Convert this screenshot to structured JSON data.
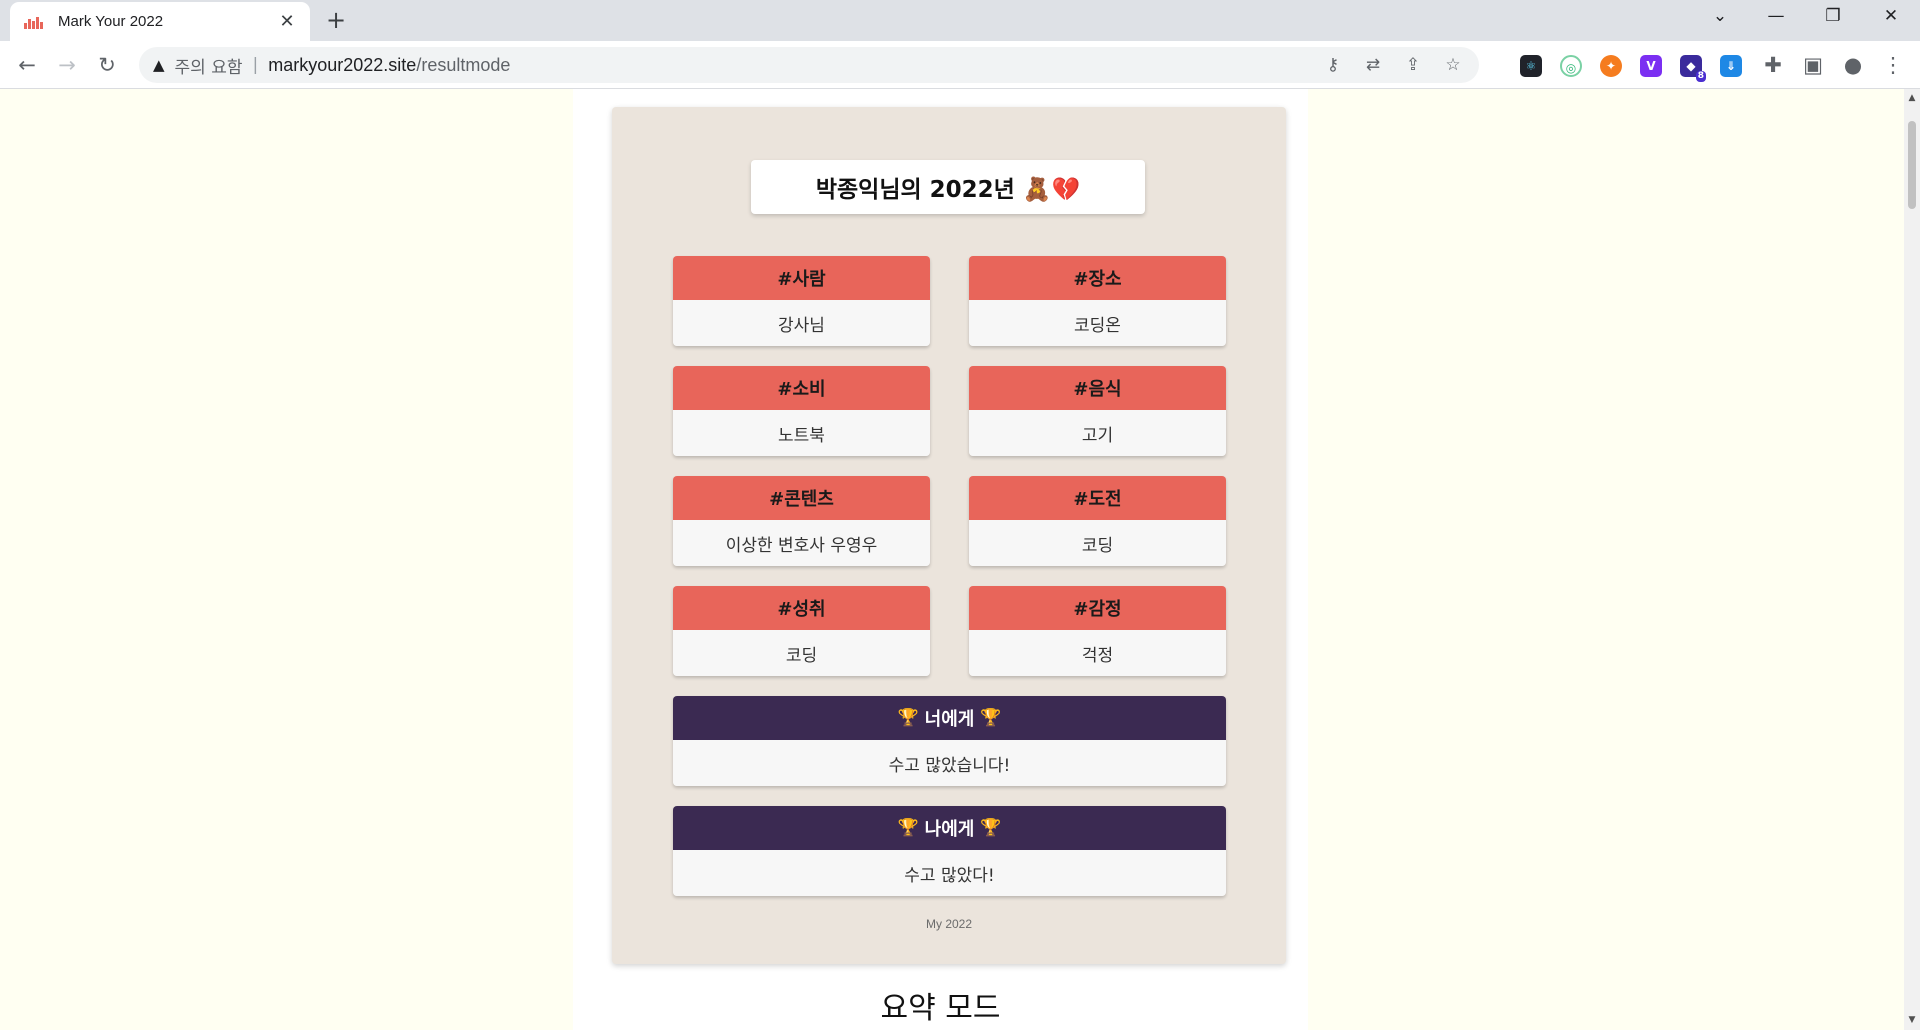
{
  "browser": {
    "tab_title": "Mark Your 2022",
    "tab_close": "✕",
    "new_tab": "+",
    "security_warning": "주의 요함",
    "url_host": "markyour2022.site",
    "url_path": "/resultmode",
    "extension_badge": "8",
    "icons": [
      "key-icon",
      "translate-icon",
      "share-icon",
      "star-icon",
      "extensions-icon",
      "profile-icon",
      "menu-icon"
    ]
  },
  "card": {
    "title": "박종익님의 2022년 🧸💔",
    "tags": [
      {
        "label": "#사람",
        "value": "강사님"
      },
      {
        "label": "#장소",
        "value": "코딩온"
      },
      {
        "label": "#소비",
        "value": "노트북"
      },
      {
        "label": "#음식",
        "value": "고기"
      },
      {
        "label": "#콘텐츠",
        "value": "이상한 변호사 우영우"
      },
      {
        "label": "#도전",
        "value": "코딩"
      },
      {
        "label": "#성취",
        "value": "코딩"
      },
      {
        "label": "#감정",
        "value": "걱정"
      }
    ],
    "to_you": {
      "label": "너에게",
      "value": "수고 많았습니다!"
    },
    "to_me": {
      "label": "나에게",
      "value": "수고 많았다!"
    },
    "trophy": "🏆",
    "footer": "My 2022"
  },
  "summary_heading": "요약 모드",
  "colors": {
    "tag_header": "#e8655a",
    "message_header": "#3b2a52",
    "card_bg": "#ebe4dc",
    "page_bg": "#fffff2"
  }
}
